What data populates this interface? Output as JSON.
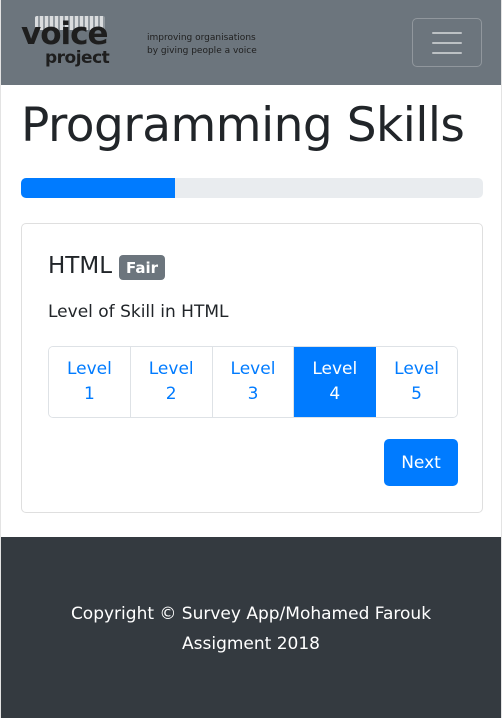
{
  "brand": {
    "logo_word1": "voice",
    "logo_word2": "project",
    "tagline_line1": "improving organisations",
    "tagline_line2": "by giving people a voice"
  },
  "navbar": {
    "toggler_icon": "hamburger-menu-icon"
  },
  "page": {
    "title": "Programming Skills"
  },
  "progress": {
    "percent": 33.3
  },
  "card": {
    "skill_name": "HTML",
    "badge": "Fair",
    "prompt": "Level of Skill in HTML",
    "levels": [
      {
        "word": "Level",
        "num": "1",
        "active": false
      },
      {
        "word": "Level",
        "num": "2",
        "active": false
      },
      {
        "word": "Level",
        "num": "3",
        "active": false
      },
      {
        "word": "Level",
        "num": "4",
        "active": true
      },
      {
        "word": "Level",
        "num": "5",
        "active": false
      }
    ],
    "next_label": "Next"
  },
  "footer": {
    "line1": "Copyright © Survey App/Mohamed Farouk",
    "line2": "Assigment 2018"
  },
  "colors": {
    "navbar": "#6c757d",
    "primary": "#007bff",
    "footer": "#343a40",
    "badge": "#6c757d"
  }
}
